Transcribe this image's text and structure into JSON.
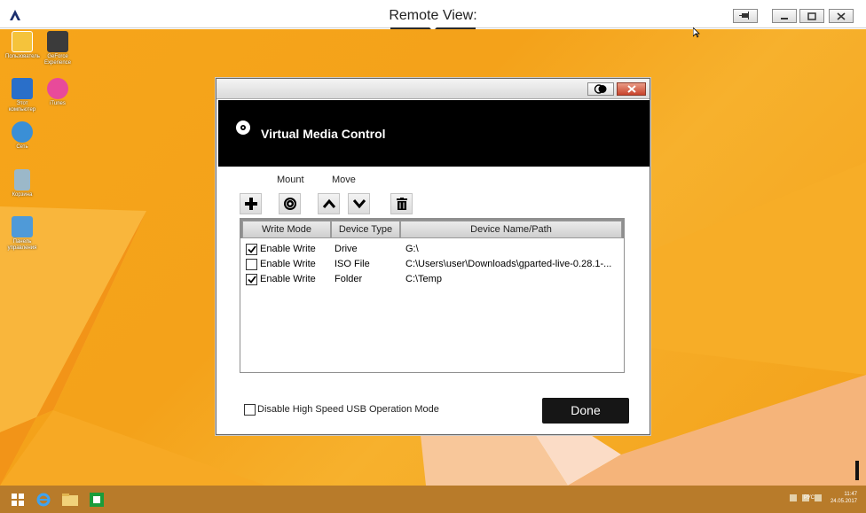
{
  "outer_window": {
    "title": "Remote View:",
    "logo_icon": "aten-logo-icon",
    "buttons": [
      "pin-icon",
      "minimize-icon",
      "restore-icon",
      "close-icon"
    ]
  },
  "desktop": {
    "icons": [
      {
        "label": "Пользователь",
        "icon": "user-folder-icon",
        "color": "#f5c33b"
      },
      {
        "label": "GeForce Experience",
        "icon": "nvidia-icon",
        "color": "#3b3b3b"
      },
      {
        "label": "Этот компьютер",
        "icon": "computer-icon",
        "color": "#2a6fc9"
      },
      {
        "label": "iTunes",
        "icon": "itunes-icon",
        "color": "#e84a9a"
      },
      {
        "label": "Сеть",
        "icon": "network-icon",
        "color": "#3a8fd6"
      },
      {
        "label": "Корзина",
        "icon": "recycle-bin-icon",
        "color": "#9bb8c9"
      },
      {
        "label": "Панель управления",
        "icon": "control-panel-icon",
        "color": "#4f9ad8"
      }
    ]
  },
  "taskbar": {
    "items": [
      "windows-start-icon",
      "internet-explorer-icon",
      "file-explorer-icon",
      "store-icon"
    ],
    "language": "РУС",
    "time": "11:47",
    "date": "24.05.2017"
  },
  "dialog": {
    "title": "Virtual Media Control",
    "toolbar": {
      "mount_label": "Mount",
      "move_label": "Move"
    },
    "columns": [
      "Write Mode",
      "Device Type",
      "Device Name/Path"
    ],
    "rows": [
      {
        "checked": true,
        "write_mode": "Enable Write",
        "device_type": "Drive",
        "path": "G:\\"
      },
      {
        "checked": false,
        "write_mode": "Enable Write",
        "device_type": "ISO File",
        "path": "C:\\Users\\user\\Downloads\\gparted-live-0.28.1-..."
      },
      {
        "checked": true,
        "write_mode": "Enable Write",
        "device_type": "Folder",
        "path": "C:\\Temp"
      }
    ],
    "disable_usb_label": "Disable High Speed USB Operation Mode",
    "disable_usb_checked": false,
    "done_label": "Done"
  },
  "colors": {
    "desktop_orange": "#f6a51a",
    "header_black": "#000000",
    "taskbar": "#b87b2a",
    "close_red": "#c8432c"
  }
}
